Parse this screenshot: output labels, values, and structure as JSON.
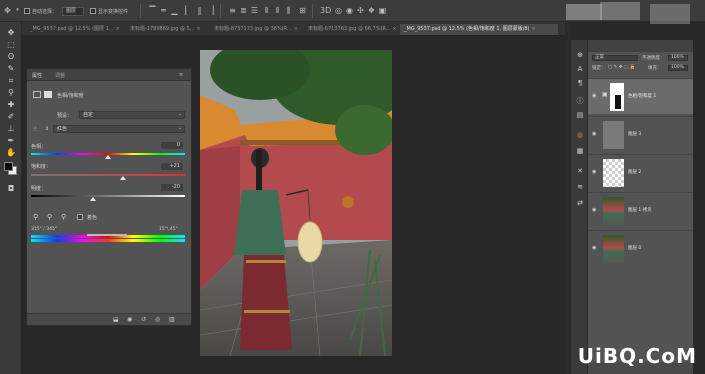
{
  "options_bar": {
    "auto_select_label": "自动选择：",
    "auto_select_value": "图层",
    "show_transform_label": "显示变换控件"
  },
  "tabs": [
    {
      "label": "_MG_9537.psd @ 12.5% (图层 1...",
      "active": false
    },
    {
      "label": "未标题-1789869.jpg @ 5...",
      "active": false
    },
    {
      "label": "未标题-8737173.jpg @ 36%(R...",
      "active": false
    },
    {
      "label": "未标题-6713763.jpg @ 66.7%(R...",
      "active": false
    },
    {
      "label": "_MG_9537.psd @ 12.5% (色相/饱和度 1, 图层蒙版/8)",
      "active": true
    }
  ],
  "properties": {
    "tab_properties": "属性",
    "tab_adjust": "调整",
    "adjustment_title": "色相/饱和度",
    "preset_label": "预设：",
    "preset_value": "自定",
    "channel_value": "红色",
    "hue_label": "色相：",
    "hue_value": "0",
    "saturation_label": "饱和度：",
    "saturation_value": "+21",
    "lightness_label": "明度：",
    "lightness_value": "-20",
    "colorize_label": "着色",
    "range_left": "315° / 345°",
    "range_right": "15°\\ 45°",
    "hue_position": 0.5,
    "saturation_position": 0.6,
    "lightness_position": 0.4
  },
  "layers": {
    "blend_mode": "正常",
    "opacity_label": "不透明度：",
    "opacity_value": "100%",
    "fill_label": "填充：",
    "fill_value": "100%",
    "lock_label": "锁定：",
    "items": [
      {
        "name": "色相/饱和度 1",
        "selected": true
      },
      {
        "name": "图层 3",
        "selected": false
      },
      {
        "name": "图层 2",
        "selected": false
      },
      {
        "name": "图层 1 拷贝",
        "selected": false
      },
      {
        "name": "图层 0",
        "selected": false
      }
    ]
  },
  "watermark": "UiBQ.CoM",
  "colors": {
    "ui_dark": "#282828",
    "panel": "#535353",
    "wall_red": "#b24a4e",
    "roof_orange": "#d98a30",
    "robe_green": "#3e6e55",
    "skirt_red": "#7a2a30"
  }
}
